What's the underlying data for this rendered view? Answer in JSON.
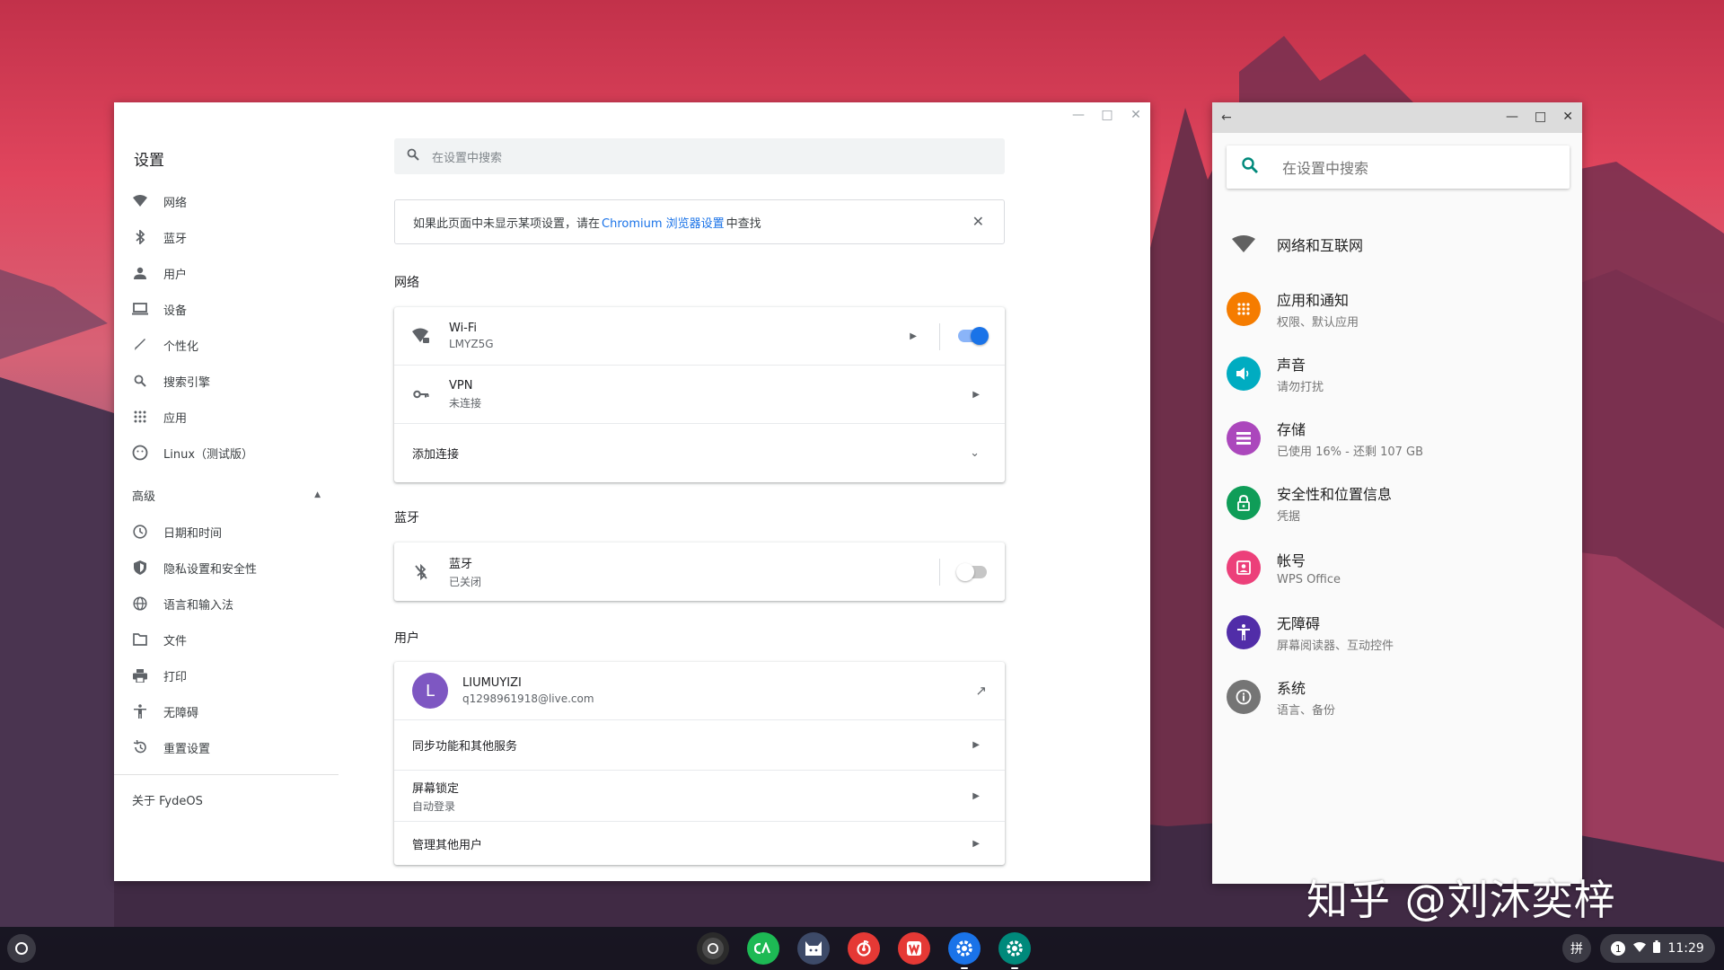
{
  "settings": {
    "app_title": "设置",
    "search_placeholder": "在设置中搜索",
    "nav": [
      "网络",
      "蓝牙",
      "用户",
      "设备",
      "个性化",
      "搜索引擎",
      "应用",
      "Linux（测试版）"
    ],
    "advanced_label": "高级",
    "advanced_nav": [
      "日期和时间",
      "隐私设置和安全性",
      "语言和输入法",
      "文件",
      "打印",
      "无障碍",
      "重置设置"
    ],
    "about": "关于 FydeOS",
    "notice": {
      "pre": "如果此页面中未显示某项设置，请在",
      "link": "Chromium 浏览器设置",
      "post": "中查找"
    },
    "network": {
      "title": "网络",
      "wifi_label": "Wi-Fi",
      "wifi_ssid": "LMYZ5G",
      "wifi_enabled": true,
      "vpn_label": "VPN",
      "vpn_status": "未连接",
      "add_connection": "添加连接"
    },
    "bluetooth": {
      "title": "蓝牙",
      "label": "蓝牙",
      "status": "已关闭",
      "enabled": false
    },
    "people": {
      "title": "用户",
      "avatar_letter": "L",
      "name": "LIUMUYIZI",
      "email": "q1298961918@live.com",
      "sync": "同步功能和其他服务",
      "screen_lock": "屏幕锁定",
      "screen_lock_sub": "自动登录",
      "manage": "管理其他用户"
    }
  },
  "android": {
    "search_placeholder": "在设置中搜索",
    "items": [
      {
        "title": "网络和互联网",
        "sub": "",
        "icon": "wifi-icon",
        "color": "#616161"
      },
      {
        "title": "应用和通知",
        "sub": "权限、默认应用",
        "icon": "apps-icon",
        "color": "#f57c00"
      },
      {
        "title": "声音",
        "sub": "请勿打扰",
        "icon": "volume-icon",
        "color": "#00acc1"
      },
      {
        "title": "存储",
        "sub": "已使用 16% - 还剩 107 GB",
        "icon": "storage-icon",
        "color": "#ab47bc"
      },
      {
        "title": "安全性和位置信息",
        "sub": "凭据",
        "icon": "lock-icon",
        "color": "#0f9d58"
      },
      {
        "title": "帐号",
        "sub": "WPS Office",
        "icon": "account-icon",
        "color": "#ec407a"
      },
      {
        "title": "无障碍",
        "sub": "屏幕阅读器、互动控件",
        "icon": "accessibility-icon",
        "color": "#512da8"
      },
      {
        "title": "系统",
        "sub": "语言、备份",
        "icon": "info-icon",
        "color": "#757575"
      }
    ]
  },
  "watermark": "知乎 @刘沐奕梓",
  "shelf": {
    "ime": "拼",
    "notification_count": "1",
    "time": "11:29"
  }
}
